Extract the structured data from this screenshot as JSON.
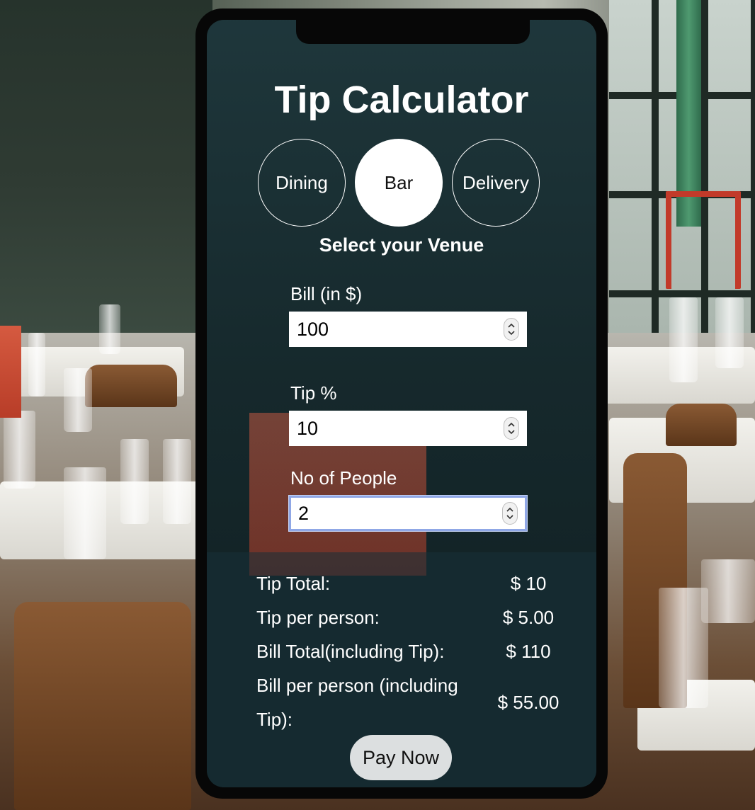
{
  "app": {
    "title": "Tip Calculator",
    "venue_caption": "Select your Venue"
  },
  "venues": [
    {
      "label": "Dining",
      "selected": false
    },
    {
      "label": "Bar",
      "selected": true
    },
    {
      "label": "Delivery",
      "selected": false
    }
  ],
  "fields": {
    "bill": {
      "label": "Bill (in $)",
      "value": "100"
    },
    "tip": {
      "label": "Tip %",
      "value": "10"
    },
    "people": {
      "label": "No of People",
      "value": "2",
      "focused": true
    }
  },
  "results": {
    "tip_total": {
      "label": "Tip Total:",
      "value": "$ 10"
    },
    "tip_per_person": {
      "label": "Tip per person:",
      "value": "$ 5.00"
    },
    "bill_total": {
      "label": "Bill Total(including Tip):",
      "value": "$ 110"
    },
    "bill_per_person": {
      "label_line1": "Bill per person (including",
      "label_line2": "Tip):",
      "value": "$ 55.00"
    }
  },
  "actions": {
    "pay_label": "Pay Now"
  },
  "colors": {
    "accent": "#ffffff",
    "focus_ring": "#8fa7e6"
  }
}
